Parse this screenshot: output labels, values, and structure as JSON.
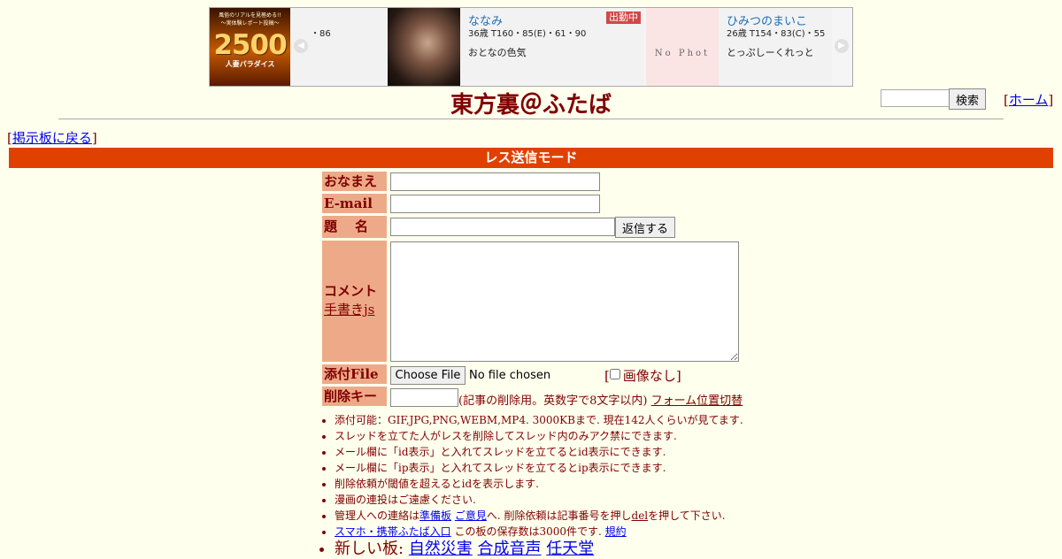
{
  "banner": {
    "ad_text_line1": "風俗のリアルを見極める!!",
    "ad_text_line2": "～実体験レポート投稿～",
    "ad_big": "2500",
    "ad_text_line3": "人妻パラダイス",
    "fragment_text": "・86",
    "cards": [
      {
        "name": "ななみ",
        "stats": "36歳 T160・85(E)・61・90",
        "desc": "おとなの色気",
        "badge": "出勤中"
      },
      {
        "name": "ひみつのまいこ",
        "stats": "26歳 T154・83(C)・55",
        "desc": "とっぷしーくれっと",
        "photo_text": "No Phot"
      }
    ]
  },
  "header": {
    "title": "東方裏＠ふたば",
    "search_button": "検索",
    "home_link": "ホーム",
    "back_link": "掲示板に戻る"
  },
  "mode_bar": "レス送信モード",
  "form": {
    "name_label": "おなまえ",
    "email_label": "E-mail",
    "subject_label": "題名",
    "reply_button": "返信する",
    "comment_label": "コメント",
    "handwrite_link": "手書きjs",
    "file_label": "添付File",
    "choose_file_button": "Choose File",
    "no_file_text": "No file chosen",
    "no_image_label": "画像なし]",
    "delkey_label": "削除キー",
    "delkey_note": "(記事の削除用。英数字で8文字以内)",
    "form_position_link": "フォーム位置切替"
  },
  "notes": {
    "n1": "添付可能：GIF,JPG,PNG,WEBM,MP4. 3000KBまで. 現在142人くらいが見てます.",
    "n2": "スレッドを立てた人がレスを削除してスレッド内のみアク禁にできます.",
    "n3": "メール欄に「id表示」と入れてスレッドを立てるとid表示にできます.",
    "n4": "メール欄に「ip表示」と入れてスレッドを立てるとip表示にできます.",
    "n5": "削除依頼が閾値を超えるとidを表示します.",
    "n6": "漫画の連投はご遠慮ください.",
    "n7_pre": "管理人への連絡は",
    "n7_link1": "準備板",
    "n7_link2": "ご意見",
    "n7_mid": "へ. 削除依頼は記事番号を押し",
    "n7_link3": "del",
    "n7_post": "を押して下さい.",
    "n8_link": "スマホ・携帯ふたば入口",
    "n8_mid": "この板の保存数は3000件です.",
    "n8_link2": "規約",
    "n9_pre": "新しい板:",
    "n9_links": [
      "自然災害",
      "合成音声",
      "任天堂"
    ]
  }
}
